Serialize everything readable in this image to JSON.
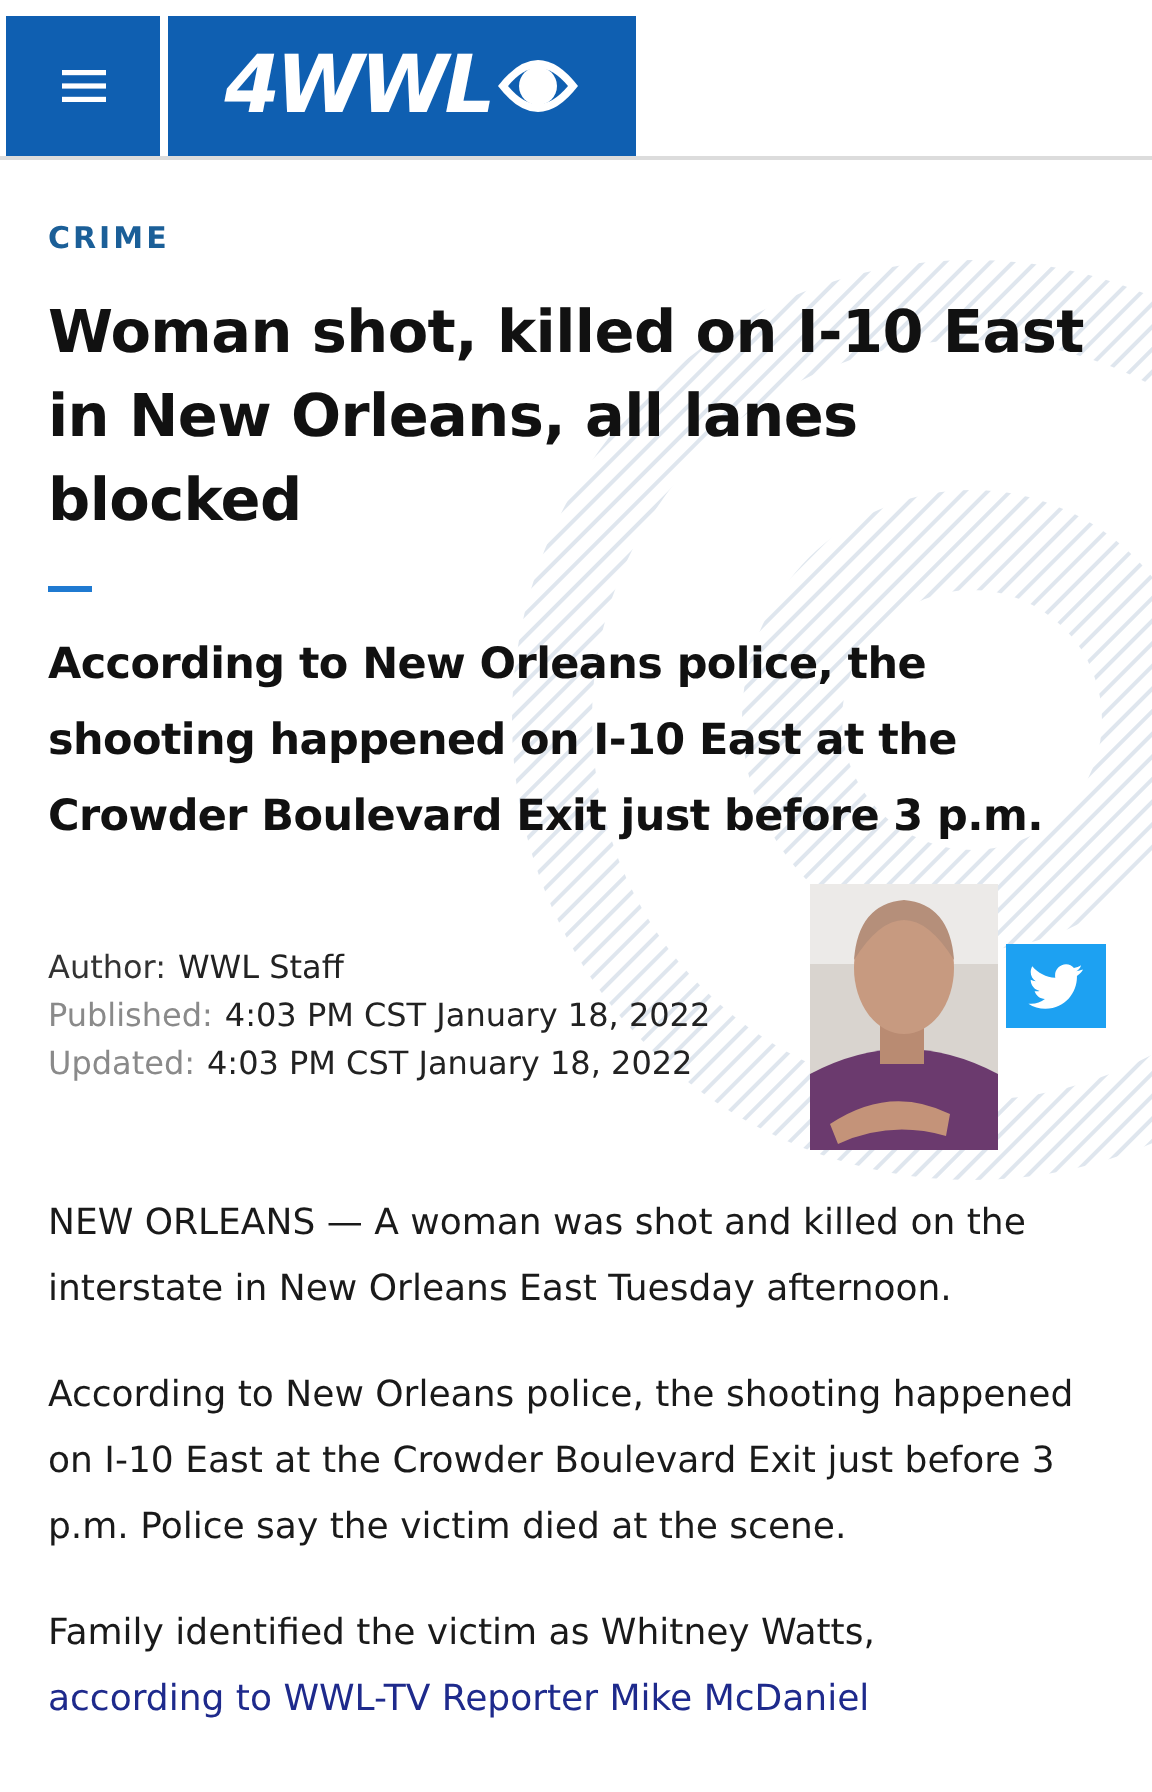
{
  "header": {
    "logo": "4WWL"
  },
  "article": {
    "category": "CRIME",
    "headline": "Woman shot, killed on I-10 East in New Orleans, all lanes blocked",
    "summary": "According to New Orleans police, the shooting happened on I-10 East at the Crowder Boulevard Exit just before 3 p.m.",
    "byline": [
      {
        "label": "Author:",
        "value": "WWL Staff"
      },
      {
        "label": "Published:",
        "value": "4:03 PM CST January 18, 2022"
      },
      {
        "label": "Updated:",
        "value": "4:03 PM CST January 18, 2022"
      }
    ],
    "share": [
      {
        "kind": "twitter"
      }
    ],
    "body": [
      {
        "text": "NEW ORLEANS — A woman was shot and killed on the interstate in New Orleans East Tuesday afternoon."
      },
      {
        "text": "According to New Orleans police, the shooting happened on I-10 East at the Crowder Boulevard Exit just before 3 p.m. Police say the victim died at the scene."
      },
      {
        "text": "Family identified the victim as Whitney Watts,",
        "link": "according to WWL-TV Reporter Mike McDaniel"
      }
    ]
  }
}
